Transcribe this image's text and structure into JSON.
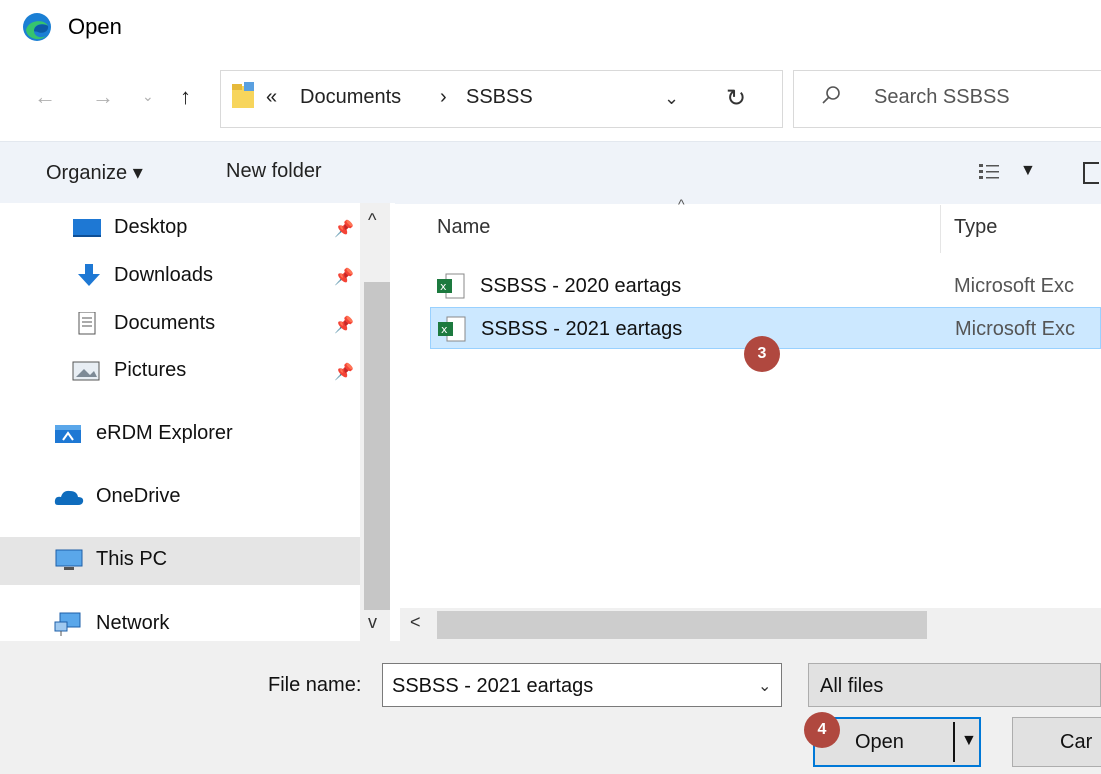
{
  "window": {
    "title": "Open"
  },
  "address": {
    "overflow": "«",
    "segments": [
      "Documents",
      "SSBSS"
    ],
    "separator": "›"
  },
  "search": {
    "placeholder": "Search SSBSS"
  },
  "toolbar": {
    "organize": "Organize ▾",
    "new_folder": "New folder"
  },
  "nav": {
    "items": [
      {
        "label": "Desktop",
        "icon": "desktop-icon",
        "pinned": true
      },
      {
        "label": "Downloads",
        "icon": "downloads-icon",
        "pinned": true
      },
      {
        "label": "Documents",
        "icon": "documents-icon",
        "pinned": true
      },
      {
        "label": "Pictures",
        "icon": "pictures-icon",
        "pinned": true
      },
      {
        "label": "eRDM Explorer",
        "icon": "erdm-icon"
      },
      {
        "label": "OneDrive",
        "icon": "onedrive-icon"
      },
      {
        "label": "This PC",
        "icon": "this-pc-icon",
        "selected": true
      },
      {
        "label": "Network",
        "icon": "network-icon"
      }
    ]
  },
  "columns": {
    "name": "Name",
    "type": "Type"
  },
  "files": [
    {
      "name": "SSBSS - 2020 eartags",
      "type": "Microsoft Exc"
    },
    {
      "name": "SSBSS - 2021 eartags",
      "type": "Microsoft Exc",
      "selected": true
    }
  ],
  "bottom": {
    "file_name_label": "File name:",
    "file_name_value": "SSBSS - 2021 eartags",
    "file_type": "All files",
    "open": "Open",
    "cancel": "Car"
  },
  "badges": {
    "step3": "3",
    "step4": "4"
  },
  "colors": {
    "accent": "#0078d7",
    "badge": "#b0483f",
    "selection": "#cce8ff",
    "toolbar": "#eff3f9"
  }
}
